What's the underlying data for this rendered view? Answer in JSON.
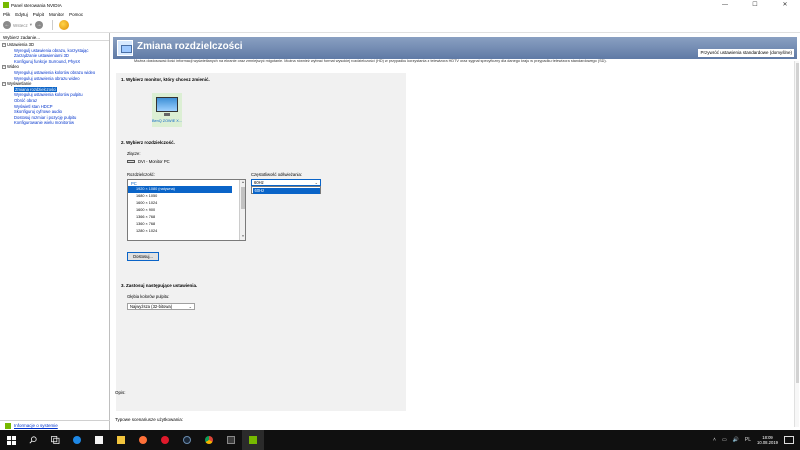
{
  "window": {
    "title": "Panel sterowania NVIDIA",
    "controls": [
      "—",
      "☐",
      "✕"
    ]
  },
  "menu": [
    "Plik",
    "Edytuj",
    "Pulpit",
    "Monitor",
    "Pomoc"
  ],
  "toolbar": {
    "back_label": "Wstecz",
    "back_glyph": "←",
    "forward_glyph": "→",
    "dropdown_glyph": "▾"
  },
  "leftpane": {
    "header": "Wybierz zadanie...",
    "tree": [
      {
        "type": "cat",
        "label": "Ustawienia 3D"
      },
      {
        "type": "leaf",
        "label": "Wyregulj ustawienia obrazu, korzystając"
      },
      {
        "type": "leaf",
        "label": "Zarządzanie ustawieniami 3D"
      },
      {
        "type": "leaf",
        "label": "Konfiguruj funkcje Surround, PhysX"
      },
      {
        "type": "cat",
        "label": "Wideo"
      },
      {
        "type": "leaf",
        "label": "Wyreguluj ustawienia kolorów obrazu wideo"
      },
      {
        "type": "leaf",
        "label": "Wyreguluj ustawienia obrazu wideo"
      },
      {
        "type": "cat",
        "label": "Wyświetlanie"
      },
      {
        "type": "leaf",
        "label": "Zmiana rozdzielczości",
        "selected": true
      },
      {
        "type": "leaf",
        "label": "Wyreguluj ustawienia kolorów pulpitu"
      },
      {
        "type": "leaf",
        "label": "Obróć obraz"
      },
      {
        "type": "leaf",
        "label": "Wyświetl stan HDCP"
      },
      {
        "type": "leaf",
        "label": "Skonfiguruj cyfrowe audio"
      },
      {
        "type": "leaf",
        "label": "Dostosuj rozmiar i pozycję pulpitu"
      },
      {
        "type": "leaf",
        "label": "Konfigurowanie wielu monitorów"
      }
    ],
    "footer_link": "Informacje o systemie"
  },
  "page": {
    "title": "Zmiana rozdzielczości",
    "restore_defaults": "Przywróć ustawienia standardowe (domyślne)",
    "description": "Można dostosować ilość informacji wyświetlanych na ekranie oraz zmniejszyć migotanie. Można również wybrać format wysokiej rozdzielczości (HD) w przypadku korzystania z telewizora HDTV oraz sygnał specyficzny dla danego kraju w przypadku telewizora standardowego (SD).",
    "section1": "1. Wybierz monitor, który chcesz zmienić.",
    "monitor_label": "BenQ ZOWIE X...",
    "section2": "2. Wybierz rozdzielczość.",
    "connector_label": "Złącze:",
    "connector_value": "DVI - Monitor PC",
    "resolution_label": "Rozdzielczość:",
    "resolution_group": "PC",
    "resolutions": [
      "1920 × 1080 (natywna)",
      "1680 × 1050",
      "1600 × 1024",
      "1600 × 900",
      "1366 × 768",
      "1360 × 768",
      "1280 × 1024"
    ],
    "selected_resolution_index": 0,
    "refresh_label": "Częstotliwość odświeżania:",
    "refresh_value": "60Hz",
    "refresh_options": [
      "60Hz"
    ],
    "customize_button": "Dostosuj...",
    "section3": "3. Zastosuj następujące ustawienia.",
    "color_depth_label": "Głębia kolorów pulpitu:",
    "color_depth_value": "Najwyższa (32-bitowa)",
    "opis_label": "Opis:",
    "typical_label": "Typowe scenariusze użytkowania:"
  },
  "taskbar": {
    "tray_symbols": [
      "˄",
      "▭",
      "🔊",
      "PL"
    ],
    "time": "18:09",
    "date": "10.08.2019"
  },
  "colors": {
    "accent": "#0a64c8",
    "nvidia_green": "#76b900",
    "banner": "#6f88b0",
    "taskbar": "#101010"
  }
}
